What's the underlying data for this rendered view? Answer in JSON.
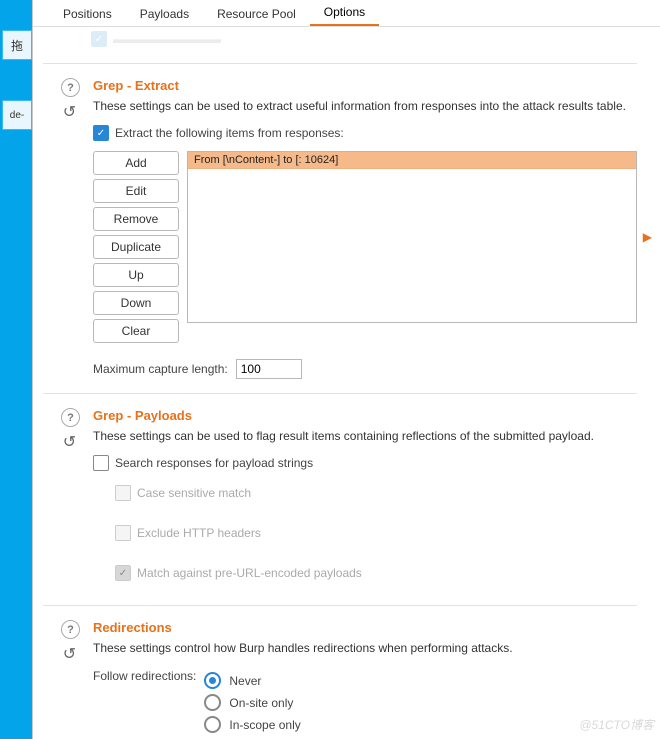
{
  "tabs": {
    "positions": "Positions",
    "payloads": "Payloads",
    "resource_pool": "Resource Pool",
    "options": "Options"
  },
  "truncated_checkbox_label": "Exclude HTTP headers",
  "extract": {
    "title": "Grep - Extract",
    "desc": "These settings can be used to extract useful information from responses into the attack results table.",
    "checkbox_label": "Extract the following items from responses:",
    "buttons": {
      "add": "Add",
      "edit": "Edit",
      "remove": "Remove",
      "duplicate": "Duplicate",
      "up": "Up",
      "down": "Down",
      "clear": "Clear"
    },
    "items": [
      "From [\\nContent-] to [: 10624]"
    ],
    "max_capture_label": "Maximum capture length:",
    "max_capture_value": "100"
  },
  "grepp": {
    "title": "Grep - Payloads",
    "desc": "These settings can be used to flag result items containing reflections of the submitted payload.",
    "main_checkbox": "Search responses for payload strings",
    "opt_case": "Case sensitive match",
    "opt_exclude": "Exclude HTTP headers",
    "opt_preurl": "Match against pre-URL-encoded payloads"
  },
  "redir": {
    "title": "Redirections",
    "desc": "These settings control how Burp handles redirections when performing attacks.",
    "follow_label": "Follow redirections:",
    "opt_never": "Never",
    "opt_onsite": "On-site only",
    "opt_inscope": "In-scope only"
  },
  "watermark": "@51CTO博客",
  "taskbar": {
    "a": "拖",
    "b": "de-"
  }
}
